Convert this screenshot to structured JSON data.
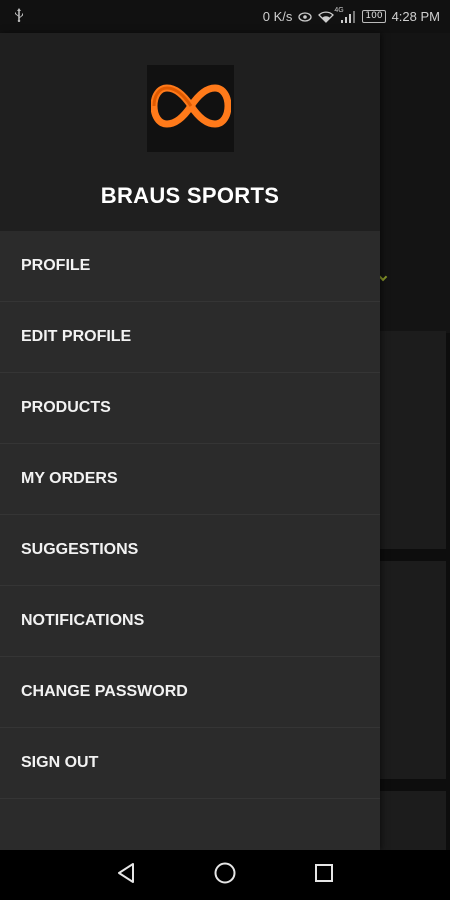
{
  "status_bar": {
    "net_speed": "0 K/s",
    "network_type": "4G",
    "battery": "100",
    "time": "4:28 PM"
  },
  "drawer": {
    "brand": "BRAUS SPORTS",
    "logo_icon": "infinity-logo-icon",
    "accent_color": "#ff7a1a",
    "menu_items": [
      {
        "label": "PROFILE"
      },
      {
        "label": "EDIT PROFILE"
      },
      {
        "label": "PRODUCTS"
      },
      {
        "label": "MY ORDERS"
      },
      {
        "label": "SUGGESTIONS"
      },
      {
        "label": "NOTIFICATIONS"
      },
      {
        "label": "CHANGE PASSWORD"
      },
      {
        "label": "SIGN OUT"
      }
    ]
  },
  "nav_bar": {
    "back_icon": "back-triangle-icon",
    "home_icon": "home-circle-icon",
    "recents_icon": "recents-square-icon"
  }
}
